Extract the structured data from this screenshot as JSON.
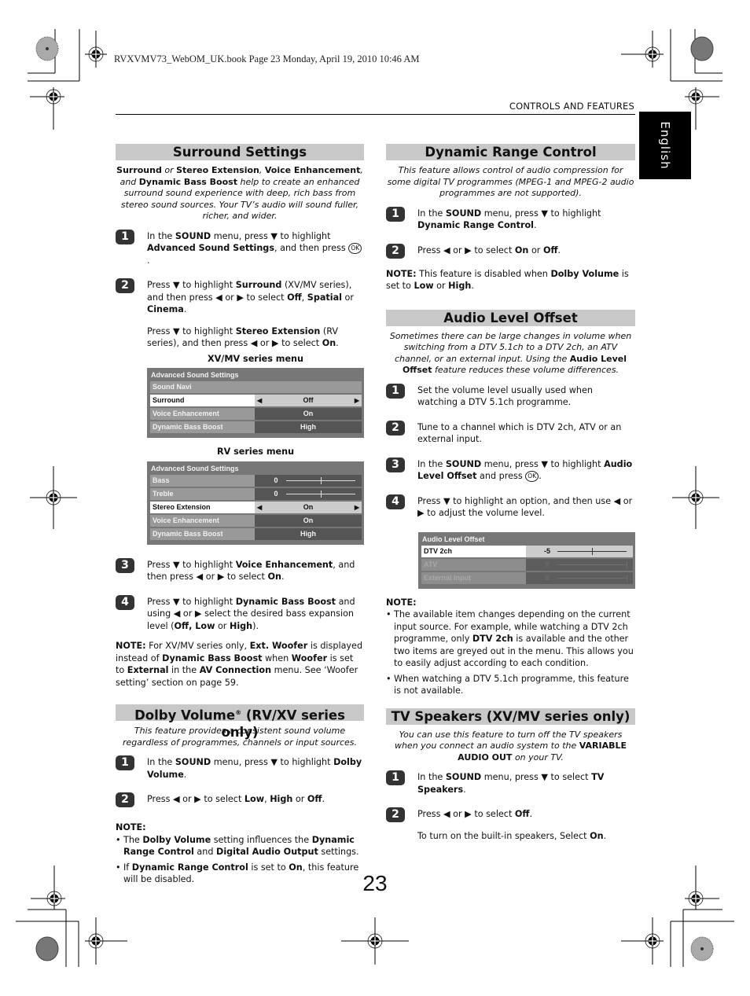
{
  "book_info": "RVXVMV73_WebOM_UK.book  Page 23  Monday, April 19, 2010  10:46 AM",
  "running_head": "CONTROLS AND FEATURES",
  "language_tab": "English",
  "page_number": "23",
  "surround": {
    "title": "Surround Settings",
    "intro_html": "<b>Surround</b> or <b>Stereo Extension</b>, <b>Voice Enhancement</b>, and <b>Dynamic Bass Boost</b> help to create an enhanced surround sound experience with deep, rich bass from stereo sound sources. Your TV’s audio will sound fuller, richer, and wider.",
    "steps": [
      {
        "num": "1",
        "paras": [
          "In the <b>SOUND</b> menu, press ▼ to highlight <b>Advanced Sound Settings</b>, and then press <span class=\"ok\">OK</span>."
        ]
      },
      {
        "num": "2",
        "paras": [
          "Press ▼ to highlight <b>Surround</b> (XV/MV series), and then press ◀ or ▶ to select <b>Off</b>, <b>Spatial</b> or <b>Cinema</b>.",
          "Press ▼ to highlight <b>Stereo Extension</b> (RV series), and then press ◀ or ▶ to select <b>On</b>."
        ]
      },
      {
        "num": "3",
        "paras": [
          "Press ▼ to highlight <b>Voice Enhancement</b>, and then press ◀ or ▶ to select <b>On</b>."
        ]
      },
      {
        "num": "4",
        "paras": [
          "Press ▼ to highlight <b>Dynamic Bass Boost</b> and using ◀ or ▶ select the desired bass expansion level (<b>Off, Low</b> or <b>High</b>)."
        ]
      }
    ],
    "xv_menu": {
      "caption": "XV/MV series menu",
      "title": "Advanced Sound Settings",
      "rows": [
        {
          "label": "Sound Navi",
          "value": "",
          "type": "full"
        },
        {
          "label": "Surround",
          "value": "Off",
          "type": "select",
          "selected": true
        },
        {
          "label": "Voice Enhancement",
          "value": "On",
          "type": "value"
        },
        {
          "label": "Dynamic Bass Boost",
          "value": "High",
          "type": "value"
        }
      ]
    },
    "rv_menu": {
      "caption": "RV series menu",
      "title": "Advanced Sound Settings",
      "rows": [
        {
          "label": "Bass",
          "value": "0",
          "type": "slider",
          "position": 0.5
        },
        {
          "label": "Treble",
          "value": "0",
          "type": "slider",
          "position": 0.5
        },
        {
          "label": "Stereo Extension",
          "value": "On",
          "type": "select",
          "selected": true
        },
        {
          "label": "Voice Enhancement",
          "value": "On",
          "type": "value"
        },
        {
          "label": "Dynamic Bass Boost",
          "value": "High",
          "type": "value"
        }
      ]
    },
    "note_html": "<b>NOTE:</b> For XV/MV series only, <b>Ext. Woofer</b> is displayed instead of <b>Dynamic Bass Boost</b> when <b>Woofer</b> is set to <b>External</b> in the <b>AV Connection</b> menu. See ‘Woofer setting’ section on page 59."
  },
  "dolby": {
    "title_html": "Dolby Volume<sup style=\"font-size:8px\">®</sup> (RV/XV series only)",
    "intro_html": "This feature provides a consistent sound volume regardless of programmes, channels or input sources.",
    "steps": [
      {
        "num": "1",
        "paras": [
          "In the <b>SOUND</b> menu, press ▼ to highlight <b>Dolby Volume</b>."
        ]
      },
      {
        "num": "2",
        "paras": [
          "Press ◀ or ▶ to select <b>Low</b>, <b>High</b> or <b>Off</b>."
        ]
      }
    ],
    "note_title": "NOTE:",
    "note_items": [
      "The <b>Dolby Volume</b> setting influences the <b>Dynamic Range Control</b> and <b>Digital Audio Output</b> settings.",
      "If <b>Dynamic Range Control</b> is set to <b>On</b>, this feature will be disabled."
    ]
  },
  "drc": {
    "title": "Dynamic Range Control",
    "intro_html": "This feature allows control of audio compression for some digital TV programmes (MPEG-1 and MPEG-2 audio programmes are not supported).",
    "steps": [
      {
        "num": "1",
        "paras": [
          "In the <b>SOUND</b> menu, press ▼ to highlight <b>Dynamic Range Control</b>."
        ]
      },
      {
        "num": "2",
        "paras": [
          "Press ◀ or ▶ to select <b>On</b> or <b>Off</b>."
        ]
      }
    ],
    "note_html": "<b>NOTE:</b> This feature is disabled when <b>Dolby Volume</b> is set to <b>Low</b> or <b>High</b>."
  },
  "alo": {
    "title": "Audio Level Offset",
    "intro_html": "Sometimes there can be large changes in volume when switching from a DTV 5.1ch to a DTV 2ch, an ATV channel, or an external input. Using the <b>Audio Level Offset</b> feature reduces these volume differences.",
    "steps": [
      {
        "num": "1",
        "paras": [
          "Set the volume level usually used when watching a DTV 5.1ch programme."
        ]
      },
      {
        "num": "2",
        "paras": [
          "Tune to a channel which is DTV 2ch, ATV or an external input."
        ]
      },
      {
        "num": "3",
        "paras": [
          "In the <b>SOUND</b> menu, press ▼ to highlight <b>Audio Level Offset</b> and press <span class=\"ok\">OK</span>."
        ]
      },
      {
        "num": "4",
        "paras": [
          "Press ▼ to highlight an option, and then use ◀ or ▶ to adjust the volume level."
        ]
      }
    ],
    "menu": {
      "title": "Audio Level Offset",
      "rows": [
        {
          "label": "DTV 2ch",
          "value": "-5",
          "type": "slider",
          "position": 0.5,
          "selected": true
        },
        {
          "label": "ATV",
          "value": "0",
          "type": "slider",
          "position": 1.0,
          "disabled": true
        },
        {
          "label": "External Input",
          "value": "0",
          "type": "slider",
          "position": 1.0,
          "disabled": true
        }
      ]
    },
    "note_title": "NOTE:",
    "note_items": [
      "The available item changes depending on the current input source. For example, while watching a DTV 2ch programme, only <b>DTV 2ch</b> is available and the other two items are greyed out in the menu. This allows you to easily adjust according to each condition.",
      "When watching a DTV 5.1ch programme, this feature is not available."
    ]
  },
  "tvspk": {
    "title": "TV Speakers (XV/MV series only)",
    "intro_html": "You can use this feature to turn off the TV speakers when you connect an audio system to the <b>VARIABLE AUDIO OUT</b> on your TV.",
    "steps": [
      {
        "num": "1",
        "paras": [
          "In the <b>SOUND</b> menu, press ▼ to select <b>TV Speakers</b>."
        ]
      },
      {
        "num": "2",
        "paras": [
          "Press ◀ or ▶ to select <b>Off</b>.",
          "To turn on the built-in speakers, Select <b>On</b>."
        ]
      }
    ]
  }
}
